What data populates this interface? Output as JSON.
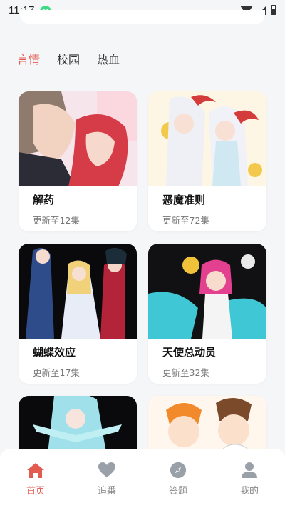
{
  "status_bar": {
    "time": "11:17"
  },
  "tabs": [
    {
      "label": "言情",
      "active": true
    },
    {
      "label": "校园",
      "active": false
    },
    {
      "label": "热血",
      "active": false
    }
  ],
  "cards": [
    {
      "title": "解药",
      "subtitle": "更新至12集"
    },
    {
      "title": "恶魔准则",
      "subtitle": "更新至72集"
    },
    {
      "title": "蝴蝶效应",
      "subtitle": "更新至17集"
    },
    {
      "title": "天使总动员",
      "subtitle": "更新至32集"
    },
    {
      "title": "",
      "subtitle": ""
    },
    {
      "title": "",
      "subtitle": ""
    }
  ],
  "bottom_nav": [
    {
      "label": "首页",
      "icon": "home-icon",
      "active": true
    },
    {
      "label": "追番",
      "icon": "heart-icon",
      "active": false
    },
    {
      "label": "答题",
      "icon": "compass-icon",
      "active": false
    },
    {
      "label": "我的",
      "icon": "user-icon",
      "active": false
    }
  ],
  "colors": {
    "accent": "#e35a50",
    "inactive": "#9aa0a8",
    "background": "#f5f6f8"
  }
}
